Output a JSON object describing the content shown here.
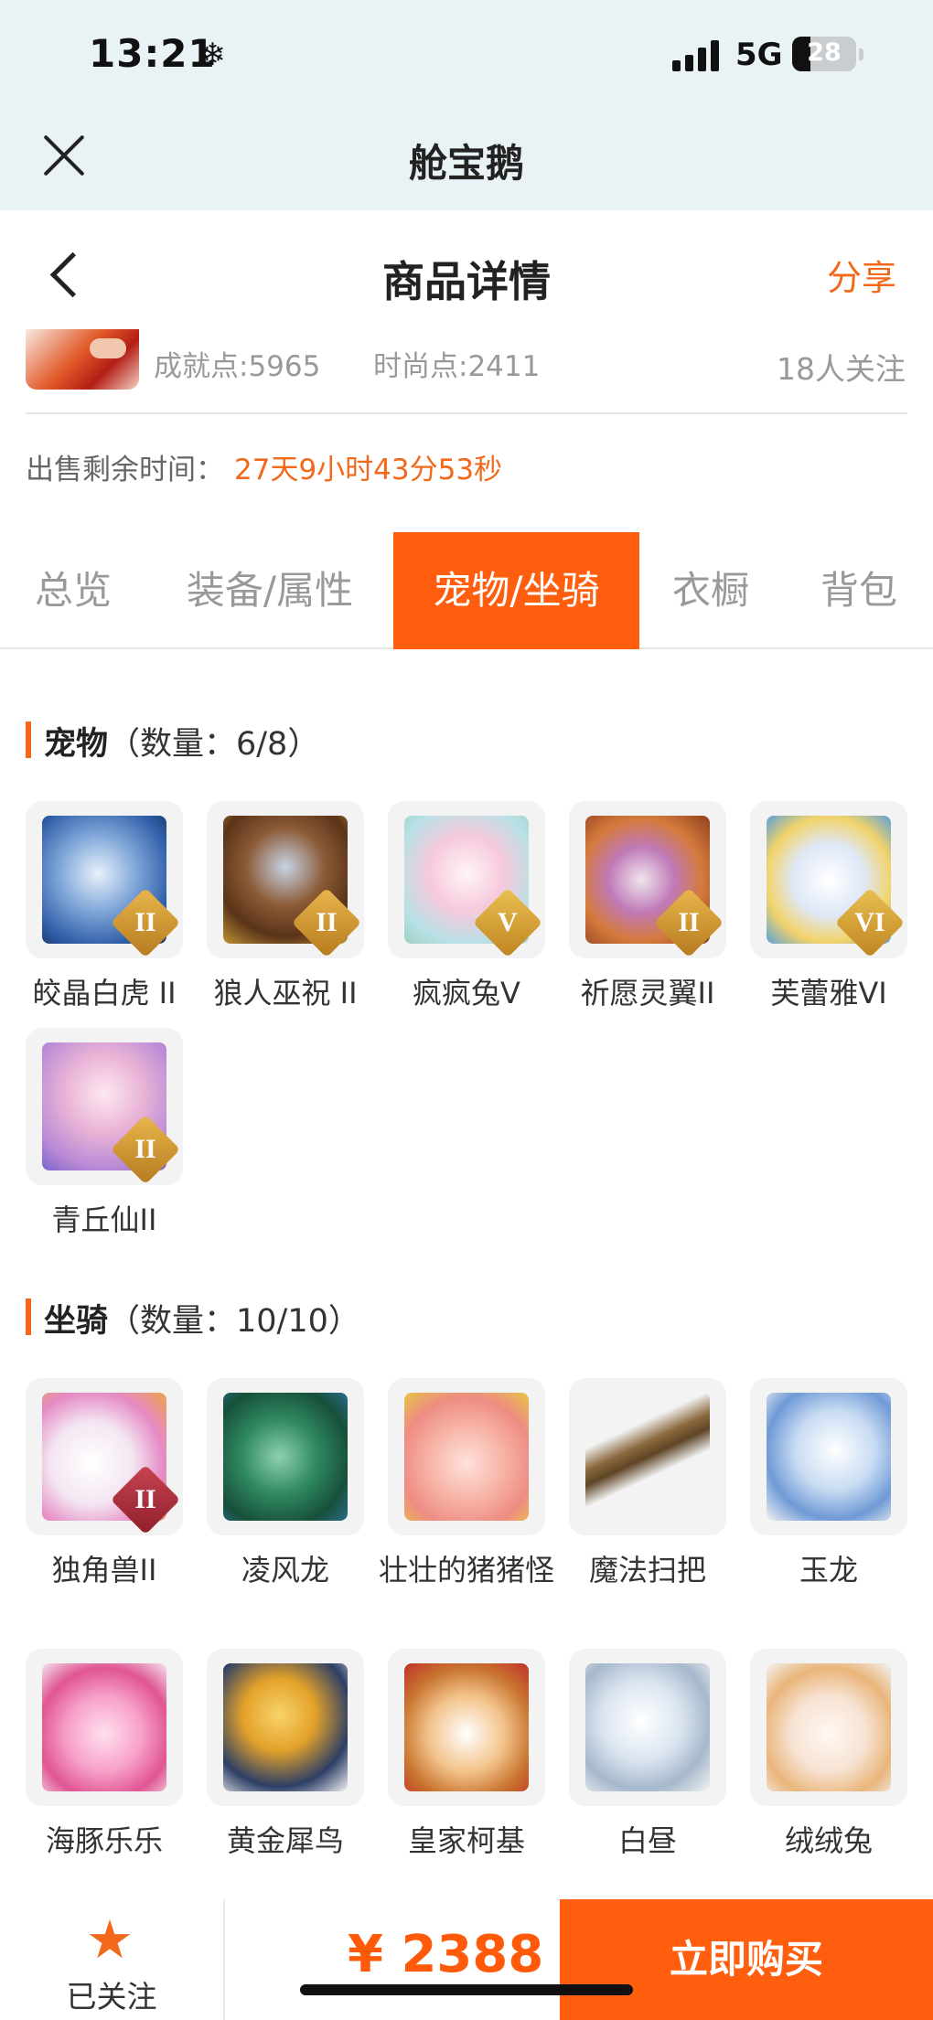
{
  "status_bar": {
    "time": "13:21",
    "network": "5G",
    "battery": "28",
    "battery_level": 0.28
  },
  "mini_app": {
    "title": "舱宝鹅"
  },
  "header": {
    "title": "商品详情",
    "share_label": "分享"
  },
  "seller": {
    "achievement": "成就点:5965",
    "fashion": "时尚点:2411",
    "followers": "18人关注"
  },
  "sale": {
    "time_label": "出售剩余时间：",
    "time_value": "27天9小时43分53秒"
  },
  "tabs": [
    {
      "label": "总览"
    },
    {
      "label": "装备/属性"
    },
    {
      "label": "宠物/坐骑"
    },
    {
      "label": "衣橱"
    },
    {
      "label": "背包"
    }
  ],
  "active_tab": "宠物/坐骑",
  "pets": {
    "title": "宠物",
    "count": "（数量：6/8）",
    "items": [
      {
        "name": "皎晶白虎 II",
        "badge": "II"
      },
      {
        "name": "狼人巫祝 II",
        "badge": "II"
      },
      {
        "name": "疯疯兔V",
        "badge": "V"
      },
      {
        "name": "祈愿灵翼II",
        "badge": "II"
      },
      {
        "name": "芙蕾雅VI",
        "badge": "VI"
      },
      {
        "name": "青丘仙II",
        "badge": "II"
      }
    ]
  },
  "mounts": {
    "title": "坐骑",
    "count": "（数量：10/10）",
    "items": [
      {
        "name": "独角兽II",
        "badge": "II"
      },
      {
        "name": "凌风龙",
        "badge": ""
      },
      {
        "name": "壮壮的猪猪怪",
        "badge": ""
      },
      {
        "name": "魔法扫把",
        "badge": ""
      },
      {
        "name": "玉龙",
        "badge": ""
      },
      {
        "name": "海豚乐乐",
        "badge": ""
      },
      {
        "name": "黄金犀鸟",
        "badge": ""
      },
      {
        "name": "皇家柯基",
        "badge": ""
      },
      {
        "name": "白昼",
        "badge": ""
      },
      {
        "name": "绒绒兔",
        "badge": ""
      }
    ]
  },
  "bottom": {
    "follow_label": "已关注",
    "price": "¥ 2388",
    "buy_label": "立即购买"
  },
  "colors": {
    "accent": "#ff5e0e",
    "orange_text": "#f2691c",
    "header_bg": "#e9f3f6"
  }
}
